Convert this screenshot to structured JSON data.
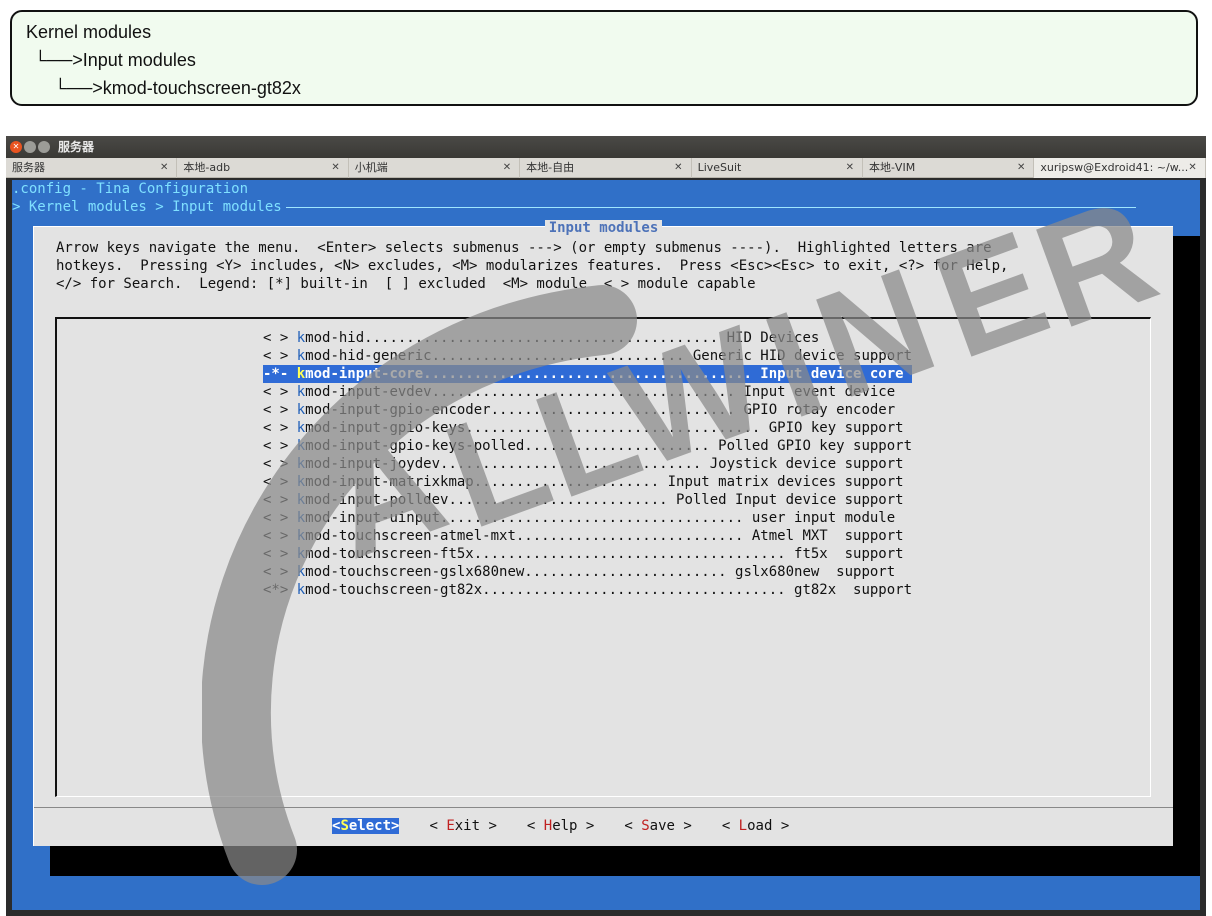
{
  "callout": {
    "line1": "Kernel modules",
    "line2": "└──>Input modules",
    "line3": "└──>kmod-touchscreen-gt82x"
  },
  "window": {
    "title": "服务器",
    "tabs": [
      {
        "label": "服务器",
        "active": false
      },
      {
        "label": "本地-adb",
        "active": false
      },
      {
        "label": "小机端",
        "active": false
      },
      {
        "label": "本地-自由",
        "active": false
      },
      {
        "label": "LiveSuit",
        "active": false
      },
      {
        "label": "本地-VIM",
        "active": false
      },
      {
        "label": "xuripsw@Exdroid41: ~/w...",
        "active": true
      }
    ]
  },
  "menuconfig": {
    "config_title": ".config - Tina Configuration",
    "breadcrumb": "> Kernel modules > Input modules",
    "dialog_title": "Input modules",
    "help": [
      "Arrow keys navigate the menu.  <Enter> selects submenus ---> (or empty submenus ----).  Highlighted letters are",
      "hotkeys.  Pressing <Y> includes, <N> excludes, <M> modularizes features.  Press <Esc><Esc> to exit, <?> for Help,",
      "</> for Search.  Legend: [*] built-in  [ ] excluded  <M> module  < > module capable"
    ],
    "items": [
      {
        "state": "< > ",
        "hotkey": "k",
        "rest": "mod-hid.......................................... HID Devices"
      },
      {
        "state": "< > ",
        "hotkey": "k",
        "rest": "mod-hid-generic.............................. Generic HID device support"
      },
      {
        "state": "-*- ",
        "hotkey": "k",
        "rest": "mod-input-core....................................... Input device core",
        "selected": true
      },
      {
        "state": "< > ",
        "hotkey": "k",
        "rest": "mod-input-evdev.................................... Input event device"
      },
      {
        "state": "< > ",
        "hotkey": "k",
        "rest": "mod-input-gpio-encoder............................. GPIO rotay encoder"
      },
      {
        "state": "< > ",
        "hotkey": "k",
        "rest": "mod-input-gpio-keys................................... GPIO key support"
      },
      {
        "state": "< > ",
        "hotkey": "k",
        "rest": "mod-input-gpio-keys-polled...................... Polled GPIO key support"
      },
      {
        "state": "< > ",
        "hotkey": "k",
        "rest": "mod-input-joydev............................... Joystick device support"
      },
      {
        "state": "< > ",
        "hotkey": "k",
        "rest": "mod-input-matrixkmap...................... Input matrix devices support"
      },
      {
        "state": "< > ",
        "hotkey": "k",
        "rest": "mod-input-polldev.......................... Polled Input device support"
      },
      {
        "state": "< > ",
        "hotkey": "k",
        "rest": "mod-input-uinput.................................... user input module"
      },
      {
        "state": "< > ",
        "hotkey": "k",
        "rest": "mod-touchscreen-atmel-mxt........................... Atmel MXT  support"
      },
      {
        "state": "< > ",
        "hotkey": "k",
        "rest": "mod-touchscreen-ft5x..................................... ft5x  support"
      },
      {
        "state": "< > ",
        "hotkey": "k",
        "rest": "mod-touchscreen-gslx680new........................ gslx680new  support"
      },
      {
        "state": "<*> ",
        "hotkey": "k",
        "rest": "mod-touchscreen-gt82x.................................... gt82x  support"
      }
    ],
    "buttons": [
      {
        "pre": "<",
        "hotkey": "S",
        "rest": "elect>",
        "active": true
      },
      {
        "pre": "< ",
        "hotkey": "E",
        "rest": "xit >",
        "active": false
      },
      {
        "pre": "< ",
        "hotkey": "H",
        "rest": "elp >",
        "active": false
      },
      {
        "pre": "< ",
        "hotkey": "S",
        "rest": "ave >",
        "active": false
      },
      {
        "pre": "< ",
        "hotkey": "L",
        "rest": "oad >",
        "active": false
      }
    ]
  },
  "watermark": {
    "text": "ALLWINNER",
    "color": "#8a8a8a"
  }
}
